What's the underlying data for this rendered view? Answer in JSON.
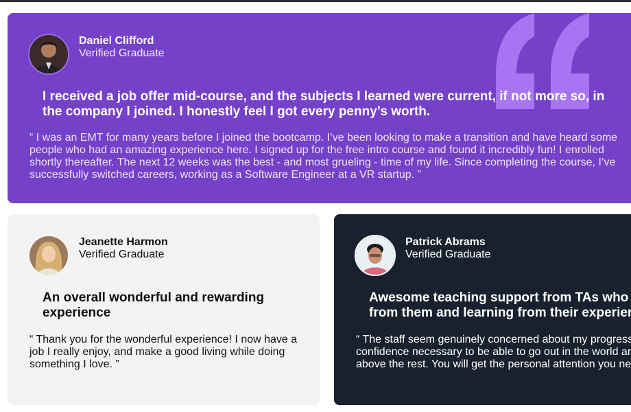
{
  "colors": {
    "purple_card": "#7541c8",
    "light_card": "#f3f3f3",
    "dark_card": "#19212e",
    "quote_mark": "#a775f1"
  },
  "testimonials": [
    {
      "name": "Daniel Clifford",
      "role": "Verified Graduate",
      "headline": "I received a job offer mid-course, and the subjects I learned were current, if not more so, in the company I joined. I honestly feel I got every penny’s worth.",
      "body": "“ I was an EMT for many years before I joined the bootcamp. I’ve been looking to make a transition and have heard some people who had an amazing experience here. I signed up for the free intro course and found it incredibly fun! I enrolled shortly thereafter. The next 12 weeks was the best - and most grueling - time of my life. Since completing the course, I’ve successfully switched careers, working as a Software Engineer at a VR startup. ”",
      "avatar_icon": "avatar-daniel"
    },
    {
      "name": "Jeanette Harmon",
      "role": "Verified Graduate",
      "headline": "An overall wonderful and rewarding experience",
      "body": "“ Thank you for the wonderful experience! I now have a job I really enjoy, and make a good living while doing something I love. ”",
      "avatar_icon": "avatar-jeanette"
    },
    {
      "name": "Patrick Abrams",
      "role": "Verified Graduate",
      "headline_line1": "Awesome teaching support from TAs who d",
      "headline_line2": "from them and learning from their experien",
      "body_line1": "“ The staff seem genuinely concerned about my progress",
      "body_line2": "confidence necessary to be able to go out in the world an",
      "body_line3": "above the rest. You will get the personal attention you ne",
      "avatar_icon": "avatar-patrick"
    }
  ]
}
